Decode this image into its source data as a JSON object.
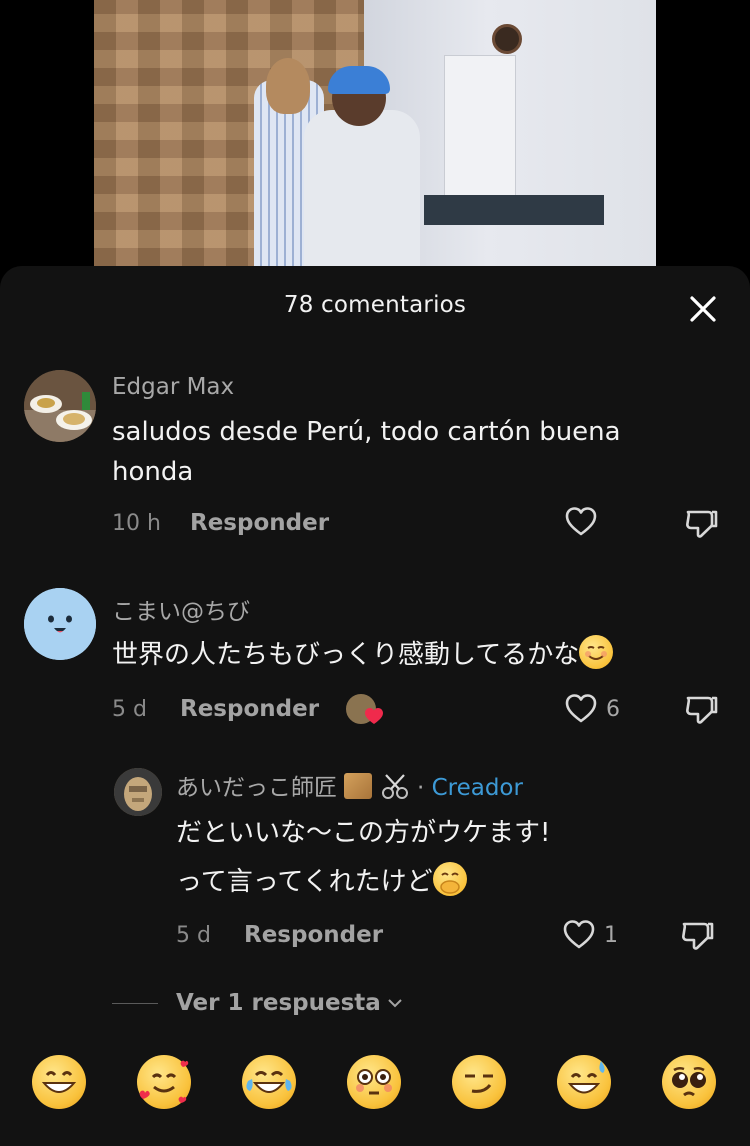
{
  "header": {
    "title": "78 comentarios"
  },
  "comments": [
    {
      "username": "Edgar Max",
      "text": "saludos desde Perú, todo cartón buena honda",
      "time": "10 h",
      "reply_label": "Responder",
      "likes": ""
    },
    {
      "username": "こまい@ちび",
      "text": "世界の人たちもびっくり感動してるかな",
      "time": "5 d",
      "reply_label": "Responder",
      "likes": "6"
    }
  ],
  "reply": {
    "username": "あいだっこ師匠",
    "separator": "·",
    "creator_badge": "Creador",
    "line1": "だといいな〜この方がウケます!",
    "line2": "って言ってくれたけど",
    "time": "5 d",
    "reply_label": "Responder",
    "likes": "1"
  },
  "view_more": {
    "label": "Ver 1 respuesta"
  },
  "emoji_bar": {
    "items": [
      "grinning-face",
      "smiling-face-with-hearts",
      "face-with-tears-of-joy",
      "flushed-face",
      "smirking-face",
      "grinning-sweat-face",
      "pleading-face"
    ]
  },
  "colors": {
    "background": "#121212",
    "creator": "#3d9ad6",
    "text": "#f2f2f2",
    "muted": "#a8a8a8"
  }
}
